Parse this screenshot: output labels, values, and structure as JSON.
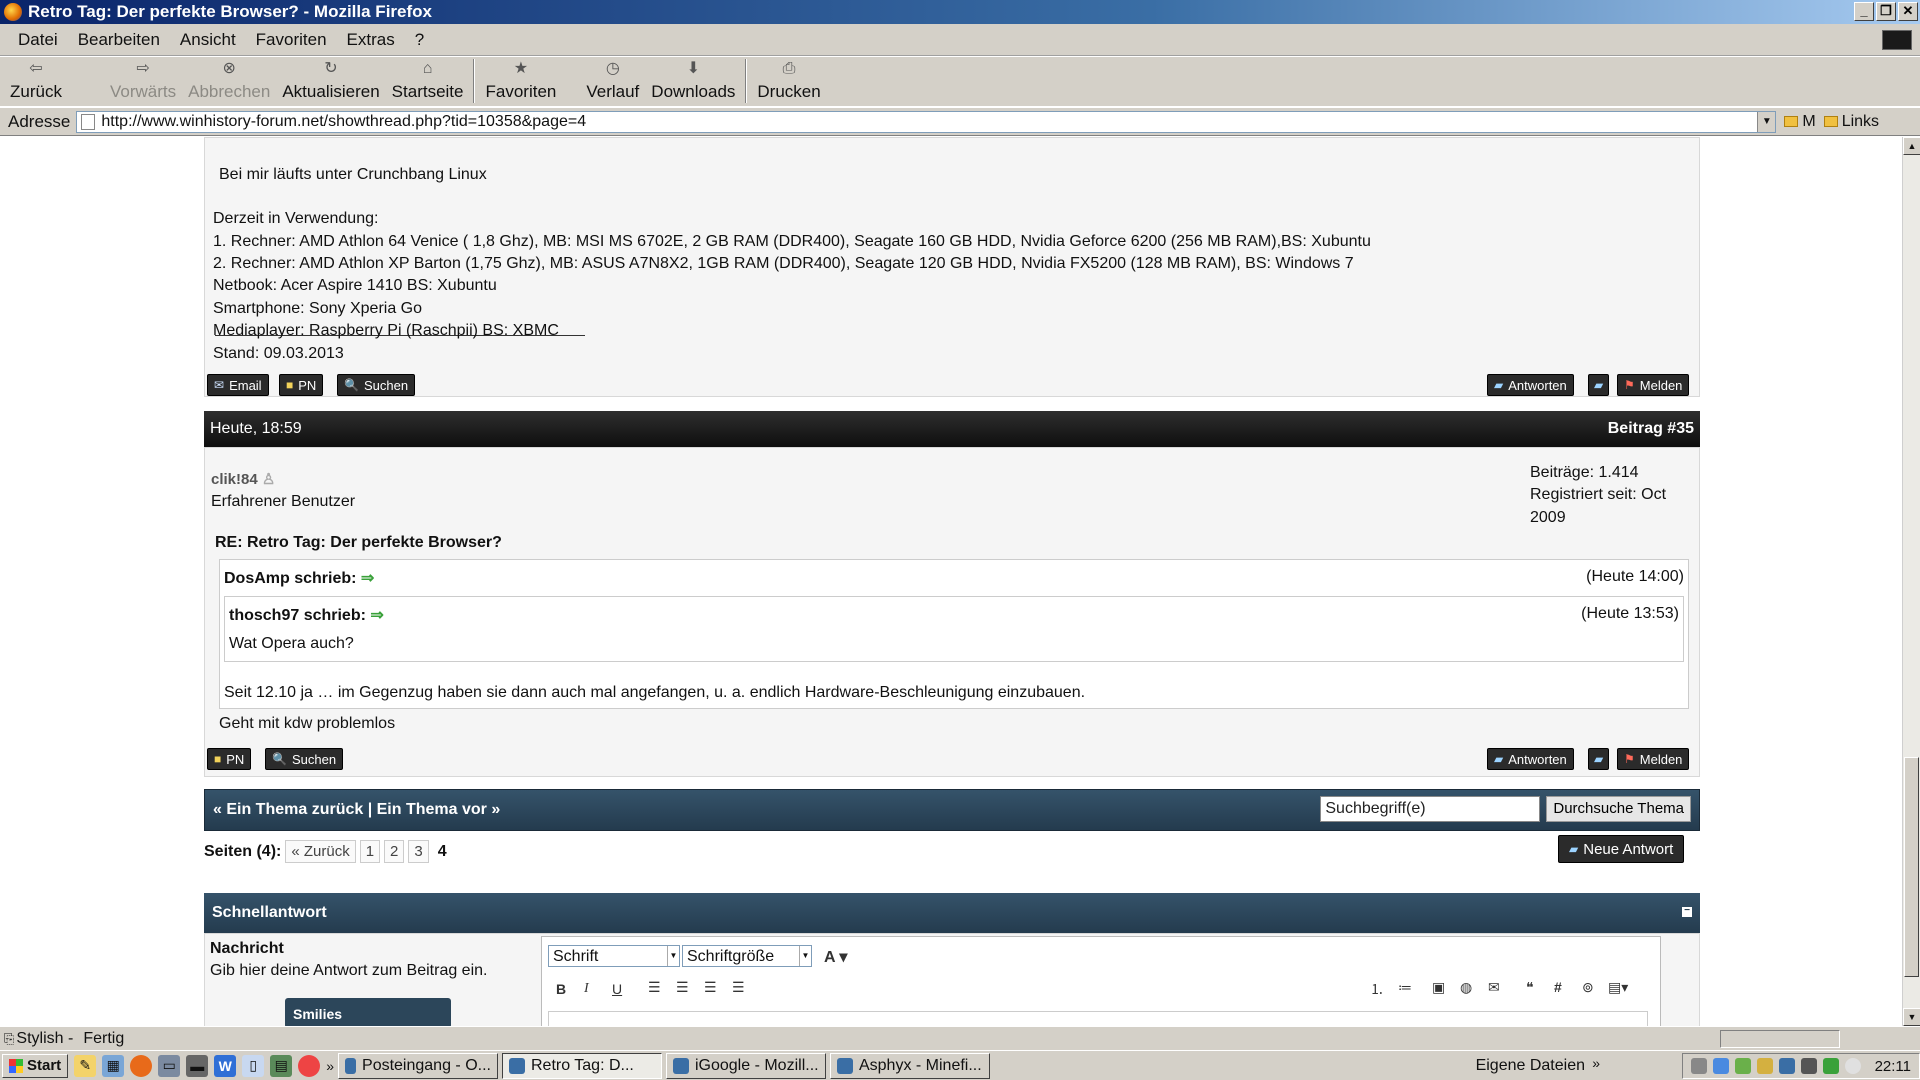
{
  "window": {
    "title": "Retro Tag: Der perfekte Browser? - Mozilla Firefox",
    "min": "_",
    "max": "❐",
    "close": "✕"
  },
  "menu": [
    "Datei",
    "Bearbeiten",
    "Ansicht",
    "Favoriten",
    "Extras",
    "?"
  ],
  "toolbar": {
    "back": "Zurück",
    "forward": "Vorwärts",
    "stop": "Abbrechen",
    "reload": "Aktualisieren",
    "home": "Startseite",
    "favorites": "Favoriten",
    "history": "Verlauf",
    "downloads": "Downloads",
    "print": "Drucken"
  },
  "address": {
    "label": "Adresse",
    "url": "http://www.winhistory-forum.net/showthread.php?tid=10358&page=4",
    "bm1": "M",
    "bm2": "Links"
  },
  "prev_post": {
    "line0": "Bei mir läufts unter Crunchbang Linux",
    "sig": [
      "Derzeit in Verwendung:",
      "1. Rechner: AMD Athlon 64 Venice ( 1,8 Ghz), MB: MSI MS 6702E, 2 GB RAM (DDR400), Seagate 160 GB HDD, Nvidia Geforce 6200 (256 MB RAM),BS: Xubuntu",
      "2. Rechner: AMD Athlon XP Barton (1,75 Ghz), MB: ASUS A7N8X2, 1GB RAM (DDR400), Seagate 120 GB HDD, Nvidia FX5200 (128 MB RAM), BS: Windows 7",
      "Netbook: Acer Aspire 1410 BS: Xubuntu",
      "Smartphone: Sony Xperia Go",
      "Mediaplayer: Raspberry Pi (Raschpii) BS: XBMC",
      "Stand: 09.03.2013"
    ],
    "btn_email": "Email",
    "btn_pn": "PN",
    "btn_search": "Suchen",
    "btn_reply": "Antworten",
    "btn_report": "Melden"
  },
  "post": {
    "date": "Heute, 18:59",
    "number": "Beitrag #35",
    "user": "clik!84",
    "rank": "Erfahrener Benutzer",
    "posts": "Beiträge: 1.414",
    "registered_1": "Registriert seit: Oct",
    "registered_2": "2009",
    "subject": "RE: Retro Tag: Der perfekte Browser?",
    "q1_author": "DosAmp schrieb:",
    "q1_time": "(Heute 14:00)",
    "q2_author": "thosch97 schrieb:",
    "q2_time": "(Heute 13:53)",
    "q2_text": "Wat Opera auch?",
    "q1_text": "Seit 12.10 ja … im Gegenzug haben sie dann auch mal angefangen, u. a. endlich Hardware-Beschleunigung einzubauen.",
    "body": "Geht mit kdw problemlos",
    "arrow": "⇒",
    "btn_pn": "PN",
    "btn_search": "Suchen",
    "btn_reply": "Antworten",
    "btn_report": "Melden"
  },
  "thread_nav": {
    "text": "« Ein Thema zurück | Ein Thema vor »",
    "search_value": "Suchbegriff(e)",
    "search_button": "Durchsuche Thema"
  },
  "pagination": {
    "label": "Seiten (4):",
    "prev": "« Zurück",
    "pages": [
      "1",
      "2",
      "3"
    ],
    "current": "4",
    "new_reply": "Neue Antwort"
  },
  "quick_reply": {
    "title": "Schnellantwort",
    "collapse": "−",
    "label": "Nachricht",
    "hint": "Gib hier deine Antwort zum Beitrag ein.",
    "smilies": "Smilies",
    "font": "Schrift",
    "size": "Schriftgröße",
    "bold": "B",
    "italic": "I",
    "underline": "U",
    "color": "A"
  },
  "status": {
    "left": "Stylish -",
    "text": "Fertig"
  },
  "taskbar": {
    "start": "Start",
    "tasks": [
      "Posteingang - O...",
      "Retro Tag: D...",
      "iGoogle - Mozill...",
      "Asphyx - Minefi..."
    ],
    "folder": "Eigene Dateien",
    "clock": "22:11"
  },
  "colors": {
    "titlebar": "#0a246a",
    "forum_dark": "#1c1c1c",
    "forum_nav": "#2c465a",
    "quote_arrow": "#3aa13a"
  }
}
